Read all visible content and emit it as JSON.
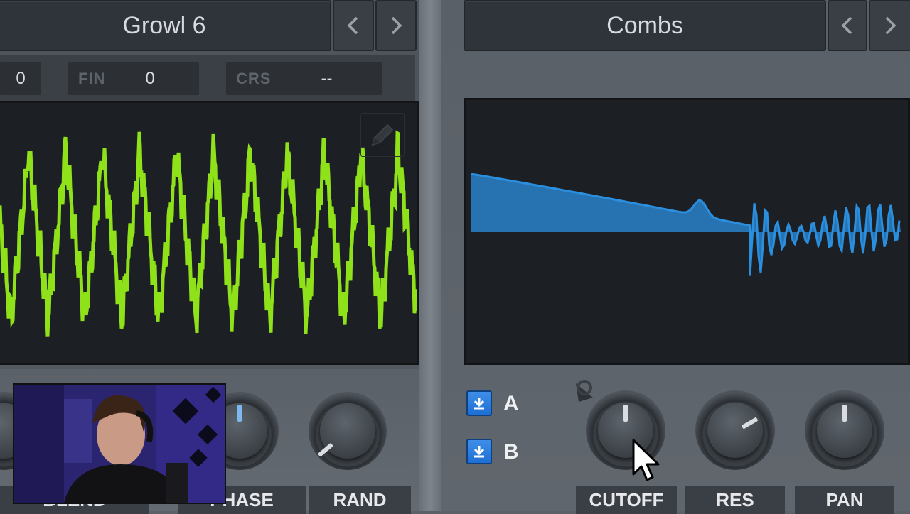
{
  "oscillator": {
    "preset_name": "Growl 6",
    "params": [
      {
        "label": "",
        "value": "0"
      },
      {
        "label": "FIN",
        "value": "0"
      },
      {
        "label": "CRS",
        "value": "--"
      }
    ],
    "wave_color": "#8fe21a",
    "knob_labels": [
      "BLEND",
      "PHASE",
      "RAND"
    ],
    "phase_level": 0.5,
    "rand_level": 0.15
  },
  "filter": {
    "preset_name": "Combs",
    "curve_color": "#2b8fe0",
    "routing": [
      {
        "label": "A",
        "icon": "down-arrow-icon"
      },
      {
        "label": "B",
        "icon": "down-arrow-icon"
      }
    ],
    "knobs": [
      {
        "label": "CUTOFF",
        "level": 0.5
      },
      {
        "label": "RES",
        "level": 0.75
      },
      {
        "label": "PAN",
        "level": 0.5
      }
    ]
  },
  "colors": {
    "accent_blue": "#3a8fe8",
    "knob_indicator": "#7fb8ec"
  }
}
